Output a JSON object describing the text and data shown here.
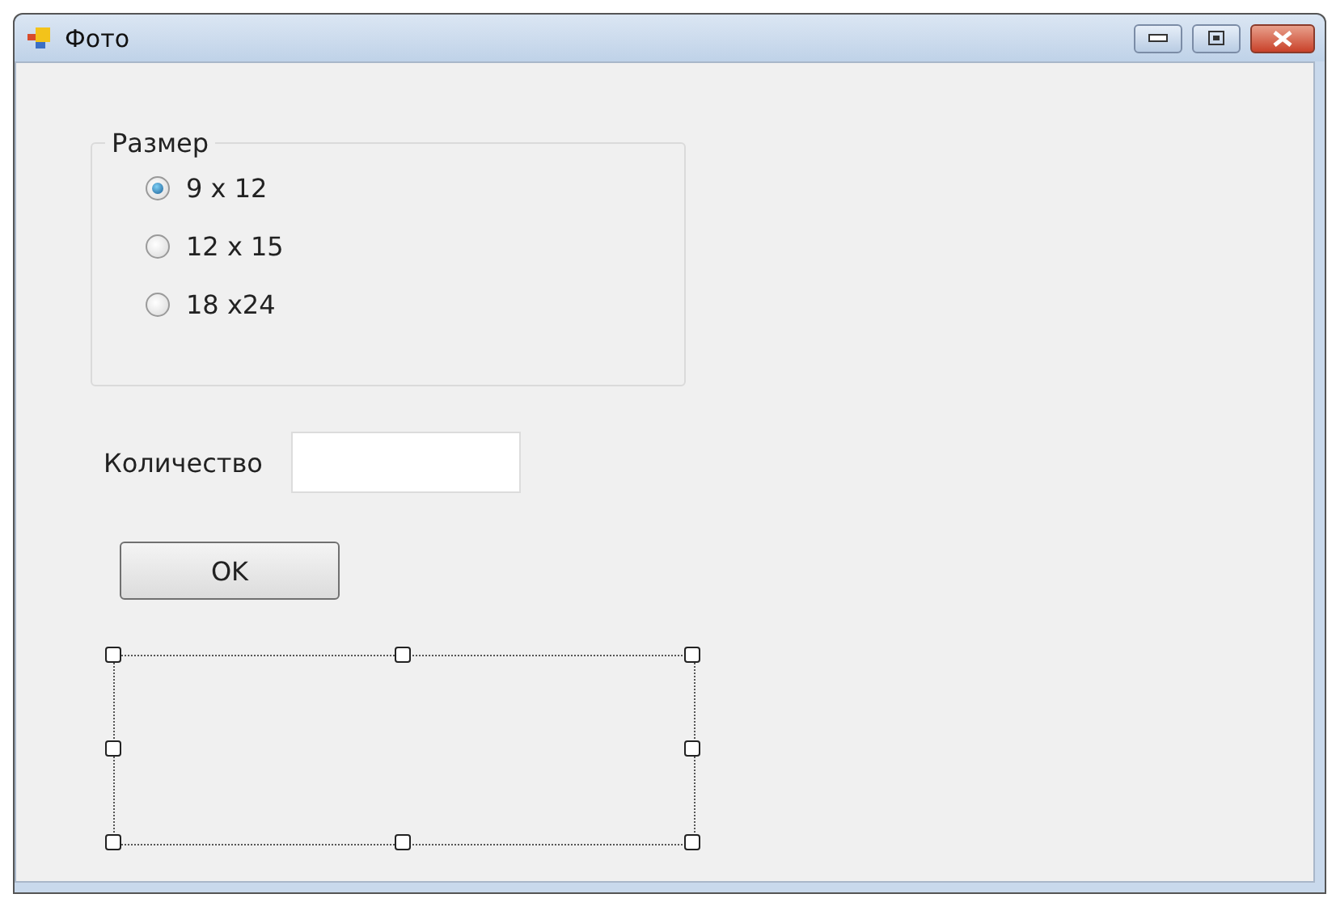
{
  "window": {
    "title": "Фото"
  },
  "size_group": {
    "title": "Размер",
    "options": [
      {
        "label": "9 x 12",
        "selected": true
      },
      {
        "label": "12 x 15",
        "selected": false
      },
      {
        "label": "18 x24",
        "selected": false
      }
    ]
  },
  "quantity": {
    "label": "Количество"
  },
  "ok_button": {
    "label": "OK"
  }
}
